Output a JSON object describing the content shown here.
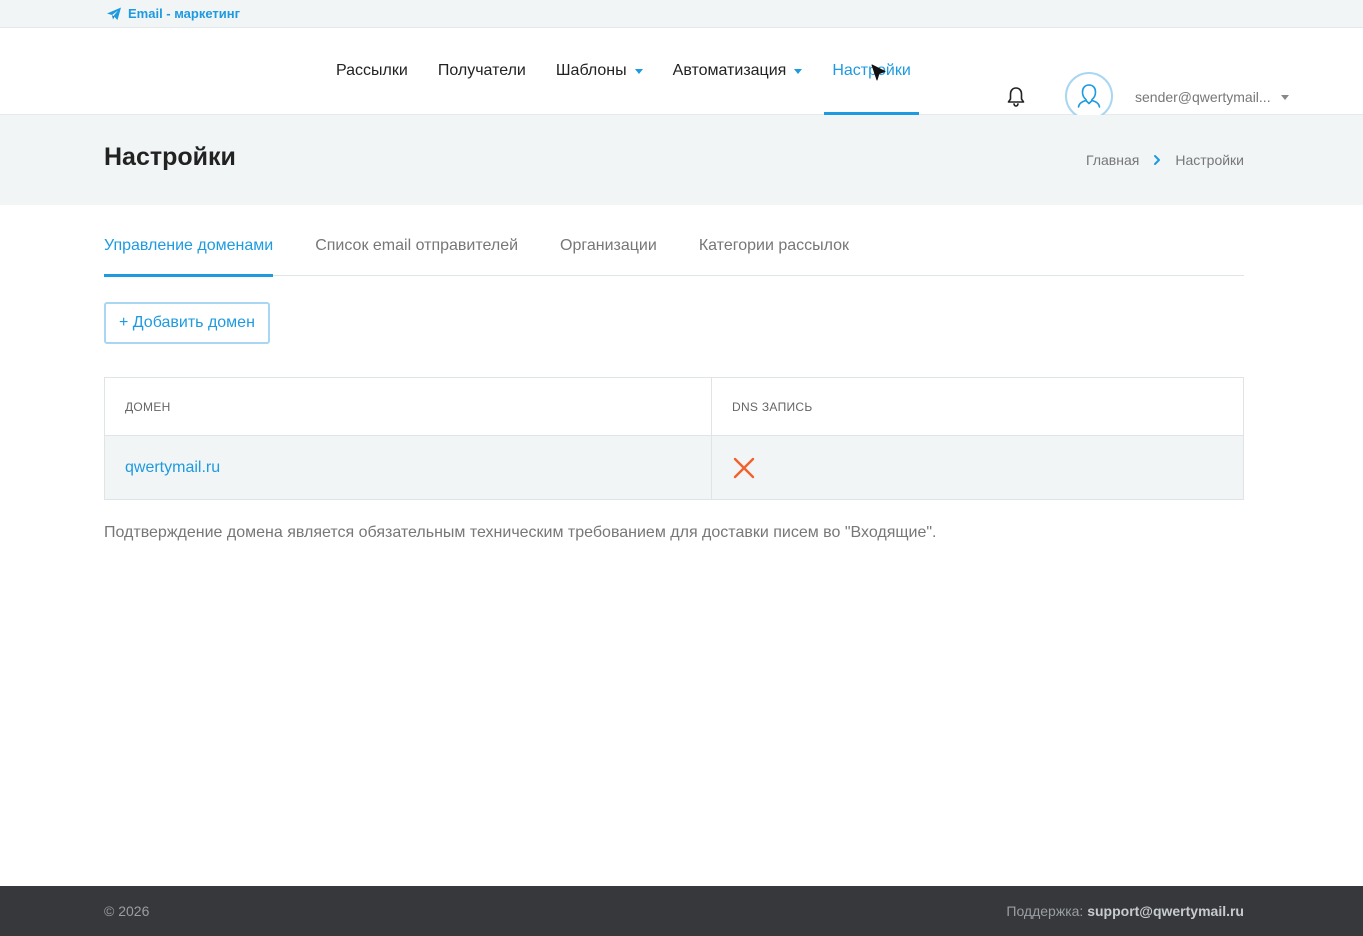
{
  "brand": {
    "label": "Email - маркетинг"
  },
  "nav": {
    "items": [
      {
        "label": "Рассылки",
        "dropdown": false,
        "active": false
      },
      {
        "label": "Получатели",
        "dropdown": false,
        "active": false
      },
      {
        "label": "Шаблоны",
        "dropdown": true,
        "active": false
      },
      {
        "label": "Автоматизация",
        "dropdown": true,
        "active": false
      },
      {
        "label": "Настройки",
        "dropdown": false,
        "active": true
      }
    ],
    "user_email": "sender@qwertymail..."
  },
  "titlebar": {
    "title": "Настройки",
    "breadcrumb": [
      "Главная",
      "Настройки"
    ]
  },
  "tabs": [
    {
      "label": "Управление доменами",
      "active": true
    },
    {
      "label": "Список email отправителей",
      "active": false
    },
    {
      "label": "Организации",
      "active": false
    },
    {
      "label": "Категории рассылок",
      "active": false
    }
  ],
  "actions": {
    "add_domain_label": "+ Добавить домен"
  },
  "table": {
    "headers": [
      "ДОМЕН",
      "DNS ЗАПИСЬ"
    ],
    "rows": [
      {
        "domain": "qwertymail.ru",
        "dns_status": "not-verified"
      }
    ]
  },
  "note": "Подтверждение домена является обязательным техническим требованием для доставки писем во \"Входящие\".",
  "footer": {
    "copyright": "© 2026",
    "support_label": "Поддержка:",
    "support_email": "support@qwertymail.ru"
  },
  "colors": {
    "accent": "#1e9ae0",
    "error": "#f0622d",
    "footer_bg": "#36383b",
    "panel_bg": "#f1f5f6"
  },
  "icons": {
    "brand": "paper-plane-icon",
    "notifications": "bell-icon",
    "avatar": "user-avatar-icon",
    "breadcrumb_sep": "chevron-right-icon",
    "dns_status": "x-mark-icon"
  }
}
